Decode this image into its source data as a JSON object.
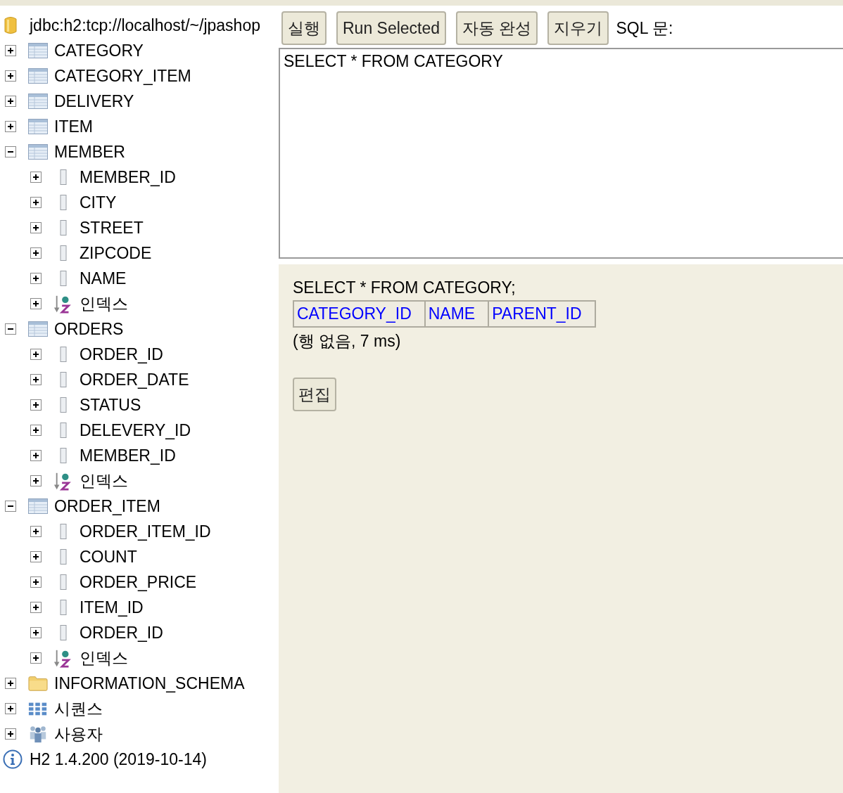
{
  "connection": {
    "label": "jdbc:h2:tcp://localhost/~/jpashop"
  },
  "tree": [
    {
      "kind": "table",
      "label": "CATEGORY",
      "expanded": false
    },
    {
      "kind": "table",
      "label": "CATEGORY_ITEM",
      "expanded": false
    },
    {
      "kind": "table",
      "label": "DELIVERY",
      "expanded": false
    },
    {
      "kind": "table",
      "label": "ITEM",
      "expanded": false
    },
    {
      "kind": "table",
      "label": "MEMBER",
      "expanded": true,
      "children": [
        {
          "kind": "column",
          "label": "MEMBER_ID",
          "expanded": false
        },
        {
          "kind": "column",
          "label": "CITY",
          "expanded": false
        },
        {
          "kind": "column",
          "label": "STREET",
          "expanded": false
        },
        {
          "kind": "column",
          "label": "ZIPCODE",
          "expanded": false
        },
        {
          "kind": "column",
          "label": "NAME",
          "expanded": false
        },
        {
          "kind": "index",
          "label": "인덱스",
          "expanded": false
        }
      ]
    },
    {
      "kind": "table",
      "label": "ORDERS",
      "expanded": true,
      "children": [
        {
          "kind": "column",
          "label": "ORDER_ID",
          "expanded": false
        },
        {
          "kind": "column",
          "label": "ORDER_DATE",
          "expanded": false
        },
        {
          "kind": "column",
          "label": "STATUS",
          "expanded": false
        },
        {
          "kind": "column",
          "label": "DELEVERY_ID",
          "expanded": false
        },
        {
          "kind": "column",
          "label": "MEMBER_ID",
          "expanded": false
        },
        {
          "kind": "index",
          "label": "인덱스",
          "expanded": false
        }
      ]
    },
    {
      "kind": "table",
      "label": "ORDER_ITEM",
      "expanded": true,
      "children": [
        {
          "kind": "column",
          "label": "ORDER_ITEM_ID",
          "expanded": false
        },
        {
          "kind": "column",
          "label": "COUNT",
          "expanded": false
        },
        {
          "kind": "column",
          "label": "ORDER_PRICE",
          "expanded": false
        },
        {
          "kind": "column",
          "label": "ITEM_ID",
          "expanded": false
        },
        {
          "kind": "column",
          "label": "ORDER_ID",
          "expanded": false
        },
        {
          "kind": "index",
          "label": "인덱스",
          "expanded": false
        }
      ]
    },
    {
      "kind": "folder",
      "label": "INFORMATION_SCHEMA",
      "expanded": false
    },
    {
      "kind": "sequence",
      "label": "시퀀스",
      "expanded": false
    },
    {
      "kind": "users",
      "label": "사용자",
      "expanded": false
    }
  ],
  "version": {
    "label": "H2 1.4.200 (2019-10-14)"
  },
  "toolbar": {
    "buttons": [
      "실행",
      "Run Selected",
      "자동 완성",
      "지우기"
    ],
    "sql_label": "SQL 문:"
  },
  "sql_editor": {
    "value": "SELECT * FROM CATEGORY"
  },
  "result": {
    "statement": "SELECT * FROM CATEGORY;",
    "columns": [
      "CATEGORY_ID",
      "NAME",
      "PARENT_ID"
    ],
    "status": "(행 없음, 7 ms)",
    "edit_button": "편집"
  }
}
